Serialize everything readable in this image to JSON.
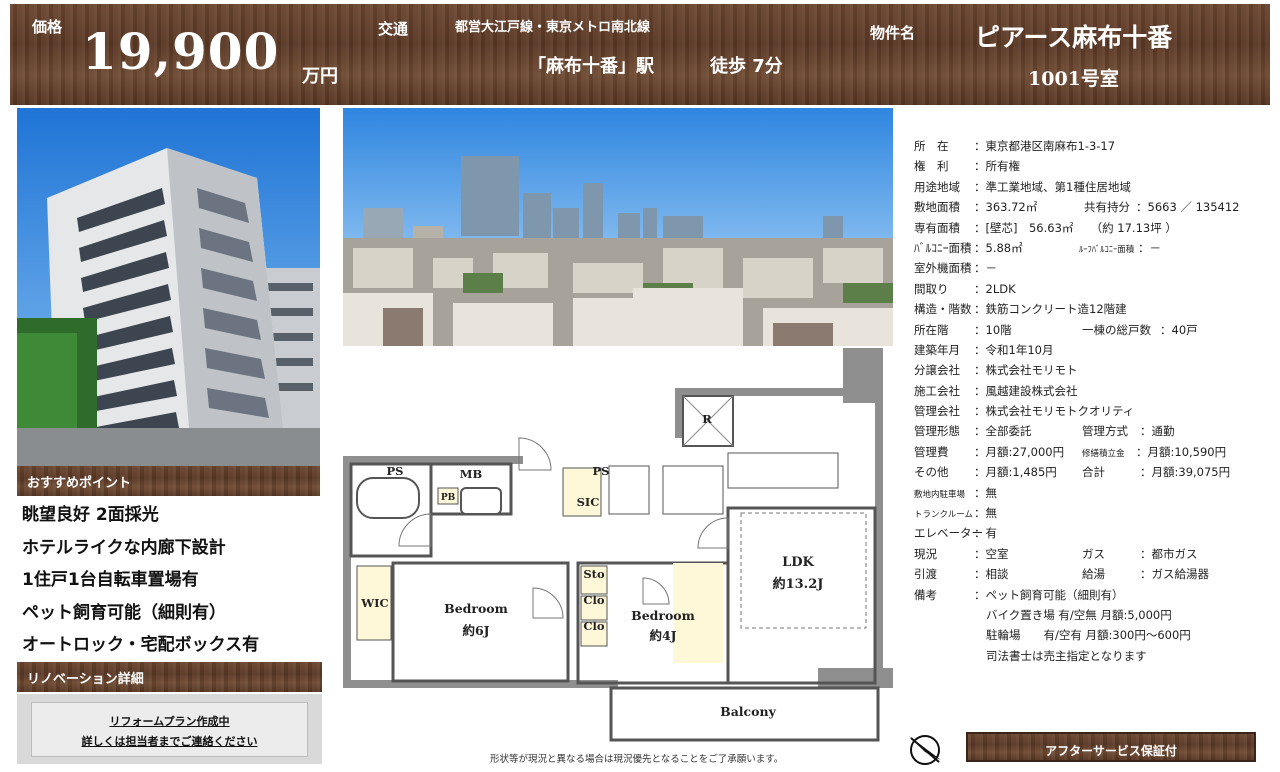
{
  "header": {
    "price_label": "価格",
    "price_value": "19,900",
    "price_unit": "万円",
    "transport_label": "交通",
    "lines": "都営大江戸線・東京メトロ南北線",
    "station": "「麻布十番」駅",
    "walk": "徒歩 7分",
    "property_label": "物件名",
    "building_name": "ピアース麻布十番",
    "room": "1001号室"
  },
  "recommend": {
    "title": "おすすめポイント",
    "items": [
      "眺望良好 2面採光",
      "ホテルライクな内廊下設計",
      "1住戸1台自転車置場有",
      "ペット飼育可能（細則有）",
      "オートロック・宅配ボックス有"
    ]
  },
  "renovation": {
    "title": "リノベーション詳細",
    "line1": "リフォームプラン作成中",
    "line2": "詳しくは担当者までご連絡ください"
  },
  "floorplan": {
    "labels": {
      "ps1": "PS",
      "mb": "MB",
      "ps2": "PS",
      "r": "R",
      "sic": "SIC",
      "pb": "PB",
      "sto": "Sto",
      "clo1": "Clo",
      "clo2": "Clo",
      "wic": "WIC",
      "bed1": "Bedroom",
      "bed1_size": "約6J",
      "bed2": "Bedroom",
      "bed2_size": "約4J",
      "ldk": "LDK",
      "ldk_size": "約13.2J",
      "balcony": "Balcony"
    },
    "note": "形状等が現況と異なる場合は現況優先となることをご了承願います。"
  },
  "details": {
    "location_label": "所　在",
    "location": "：東京都港区南麻布1-3-17",
    "rights_label": "権　利",
    "rights": "：所有権",
    "zoning_label": "用途地域",
    "zoning": "：準工業地域、第1種住居地域",
    "land_label": "敷地面積",
    "land": "：363.72㎡",
    "share_label": "共有持分",
    "share": "：5663 ／ 135412",
    "floor_area_label": "専有面積",
    "floor_area": "：[壁芯]　56.63㎡　　（約 17.13坪 ）",
    "balcony_label": "ﾊﾞﾙｺﾆｰ面積",
    "balcony": "：5.88㎡",
    "roof_label": "ﾙｰﾌﾊﾞﾙｺﾆｰ面積",
    "roof": "：－",
    "outdoor_label": "室外機面積",
    "outdoor": "：－",
    "layout_label": "間取り",
    "layout": "：2LDK",
    "structure_label": "構造・階数",
    "structure": "：鉄筋コンクリート造12階建",
    "floor_label": "所在階",
    "floor": "：10階",
    "units_label": "一棟の総戸数",
    "units": "：40戸",
    "built_label": "建築年月",
    "built": "：令和1年10月",
    "seller_label": "分譲会社",
    "seller": "：株式会社モリモト",
    "builder_label": "施工会社",
    "builder": "：風越建設株式会社",
    "manager_label": "管理会社",
    "manager": "：株式会社モリモトクオリティ",
    "mgmt_form_label": "管理形態",
    "mgmt_form": "：全部委託",
    "mgmt_type_label": "管理方式",
    "mgmt_type": "：通勤",
    "fee_label": "管理費",
    "fee": "：月額:27,000円",
    "repair_label": "修繕積立金",
    "repair": "：月額:10,590円",
    "other_label": "その他",
    "other": "：月額:1,485円",
    "total_label": "合計",
    "total": "：月額:39,075円",
    "parking_label": "敷地内駐車場",
    "parking": "：無",
    "trunk_label": "トランクルーム",
    "trunk": "：無",
    "elevator_label": "エレベーター",
    "elevator": "：有",
    "status_label": "現況",
    "status": "：空室",
    "gas_label": "ガス",
    "gas": "：都市ガス",
    "handover_label": "引渡",
    "handover": "：相談",
    "hotwater_label": "給湯",
    "hotwater": "：ガス給湯器",
    "notes_label": "備考",
    "notes1": "：ペット飼育可能（細則有）",
    "notes2": "バイク置き場 有/空無 月額:5,000円",
    "notes3": "駐輪場　　有/空有 月額:300円～600円",
    "notes4": "司法書士は売主指定となります"
  },
  "after_service": "アフターサービス保証付",
  "icons": {
    "compass": "north-compass-icon"
  }
}
